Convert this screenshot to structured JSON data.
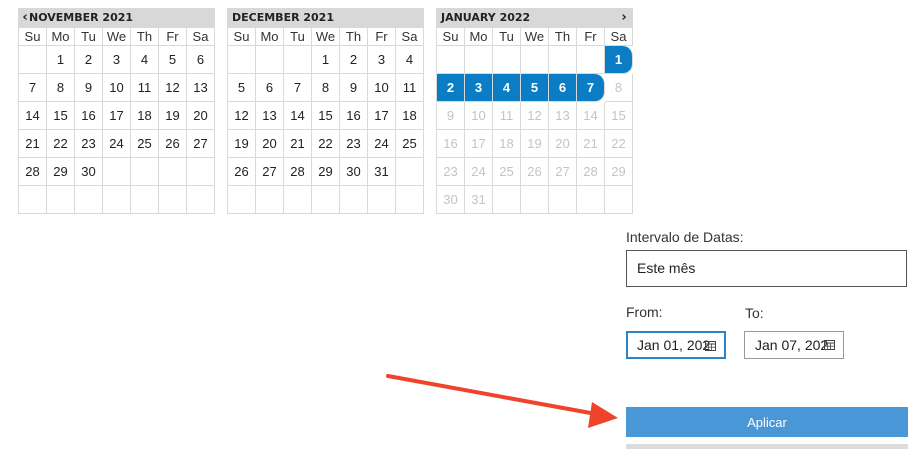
{
  "calendars": [
    {
      "title": "NOVEMBER 2021",
      "has_prev": true,
      "has_next": false,
      "weekdays": [
        "Su",
        "Mo",
        "Tu",
        "We",
        "Th",
        "Fr",
        "Sa"
      ],
      "weeks": [
        [
          "",
          "1",
          "2",
          "3",
          "4",
          "5",
          "6"
        ],
        [
          "7",
          "8",
          "9",
          "10",
          "11",
          "12",
          "13"
        ],
        [
          "14",
          "15",
          "16",
          "17",
          "18",
          "19",
          "20"
        ],
        [
          "21",
          "22",
          "23",
          "24",
          "25",
          "26",
          "27"
        ],
        [
          "28",
          "29",
          "30",
          "",
          "",
          "",
          ""
        ],
        [
          "",
          "",
          "",
          "",
          "",
          "",
          ""
        ]
      ]
    },
    {
      "title": "DECEMBER 2021",
      "has_prev": false,
      "has_next": false,
      "weekdays": [
        "Su",
        "Mo",
        "Tu",
        "We",
        "Th",
        "Fr",
        "Sa"
      ],
      "weeks": [
        [
          "",
          "",
          "",
          "1",
          "2",
          "3",
          "4"
        ],
        [
          "5",
          "6",
          "7",
          "8",
          "9",
          "10",
          "11"
        ],
        [
          "12",
          "13",
          "14",
          "15",
          "16",
          "17",
          "18"
        ],
        [
          "19",
          "20",
          "21",
          "22",
          "23",
          "24",
          "25"
        ],
        [
          "26",
          "27",
          "28",
          "29",
          "30",
          "31",
          ""
        ],
        [
          "",
          "",
          "",
          "",
          "",
          "",
          ""
        ]
      ]
    },
    {
      "title": "JANUARY 2022",
      "has_prev": false,
      "has_next": true,
      "weekdays": [
        "Su",
        "Mo",
        "Tu",
        "We",
        "Th",
        "Fr",
        "Sa"
      ],
      "weeks": [
        [
          "",
          "",
          "",
          "",
          "",
          "",
          "1"
        ],
        [
          "2",
          "3",
          "4",
          "5",
          "6",
          "7",
          "8"
        ],
        [
          "9",
          "10",
          "11",
          "12",
          "13",
          "14",
          "15"
        ],
        [
          "16",
          "17",
          "18",
          "19",
          "20",
          "21",
          "22"
        ],
        [
          "23",
          "24",
          "25",
          "26",
          "27",
          "28",
          "29"
        ],
        [
          "30",
          "31",
          "",
          "",
          "",
          "",
          ""
        ]
      ],
      "selected_days": [
        "1",
        "2",
        "3",
        "4",
        "5",
        "6",
        "7"
      ],
      "disabled_after": "7"
    }
  ],
  "range": {
    "label": "Intervalo de Datas:",
    "value": "Este mês"
  },
  "from": {
    "label": "From:",
    "value": "Jan 01, 202"
  },
  "to": {
    "label": "To:",
    "value": "Jan 07, 202"
  },
  "apply_label": "Aplicar",
  "colors": {
    "selected": "#0a7dc4",
    "apply_button": "#4a97d8",
    "arrow": "#f0432b"
  },
  "icons": {
    "prev": "chevron-left-icon",
    "next": "chevron-right-icon",
    "date_picker": "calendar-icon",
    "annotation": "red-arrow-icon"
  }
}
